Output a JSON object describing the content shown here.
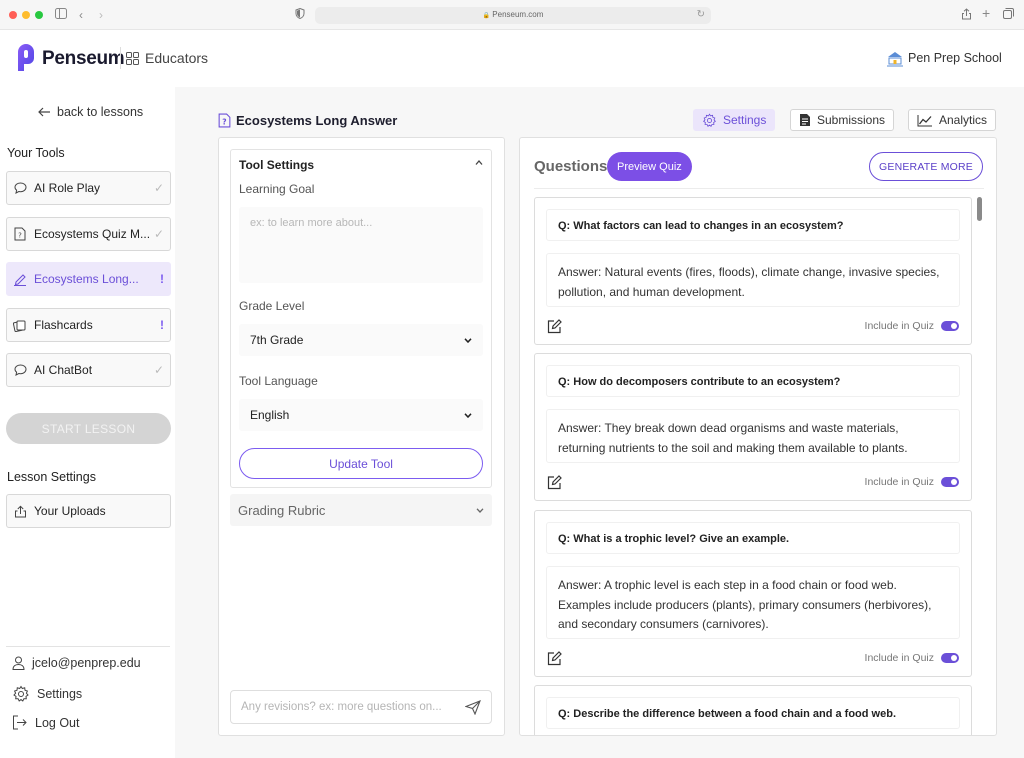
{
  "browser": {
    "url": "Penseum.com",
    "lock_glyph": "🔒"
  },
  "header": {
    "brand": "Penseum",
    "section": "Educators",
    "school": "Pen Prep School",
    "accent": "#6b4fd8"
  },
  "sidebar": {
    "back_label": "back to lessons",
    "tools_title": "Your Tools",
    "tools": [
      {
        "label": "AI Role Play",
        "icon": "chat-bubble-icon",
        "status": "✓"
      },
      {
        "label": "Ecosystems Quiz M...",
        "icon": "quiz-doc-icon",
        "status": "✓"
      },
      {
        "label": "Ecosystems Long...",
        "icon": "pen-write-icon",
        "status": "!"
      },
      {
        "label": "Flashcards",
        "icon": "cards-icon",
        "status": "!"
      },
      {
        "label": "AI ChatBot",
        "icon": "chat-bubble-icon",
        "status": "✓"
      }
    ],
    "start_label": "START LESSON",
    "lesson_settings_title": "Lesson Settings",
    "uploads_label": "Your Uploads",
    "user_email": "jcelo@penprep.edu",
    "settings_label": "Settings",
    "logout_label": "Log Out"
  },
  "main": {
    "page_title": "Ecosystems Long Answer",
    "tabs": [
      {
        "label": "Settings",
        "icon": "gear-icon"
      },
      {
        "label": "Submissions",
        "icon": "document-icon"
      },
      {
        "label": "Analytics",
        "icon": "chart-line-icon"
      }
    ]
  },
  "tool_settings": {
    "title": "Tool Settings",
    "learning_goal_label": "Learning Goal",
    "learning_goal_placeholder": "ex: to learn more about...",
    "grade_label": "Grade Level",
    "grade_value": "7th Grade",
    "language_label": "Tool Language",
    "language_value": "English",
    "update_label": "Update Tool",
    "rubric_label": "Grading Rubric",
    "revision_placeholder": "Any revisions? ex: more questions on..."
  },
  "questions": {
    "title": "Questions",
    "preview_label": "Preview Quiz",
    "generate_label": "GENERATE MORE",
    "include_label": "Include in Quiz",
    "items": [
      {
        "q": "Q: What factors can lead to changes in an ecosystem?",
        "a": "Answer: Natural events (fires, floods), climate change, invasive species, pollution, and human development."
      },
      {
        "q": "Q: How do decomposers contribute to an ecosystem?",
        "a": "Answer: They break down dead organisms and waste materials, returning nutrients to the soil and making them available to plants."
      },
      {
        "q": "Q: What is a trophic level? Give an example.",
        "a": "Answer: A trophic level is each step in a food chain or food web. Examples include producers (plants), primary consumers (herbivores), and secondary consumers (carnivores)."
      },
      {
        "q": "Q: Describe the difference between a food chain and a food web.",
        "a": ""
      }
    ]
  }
}
